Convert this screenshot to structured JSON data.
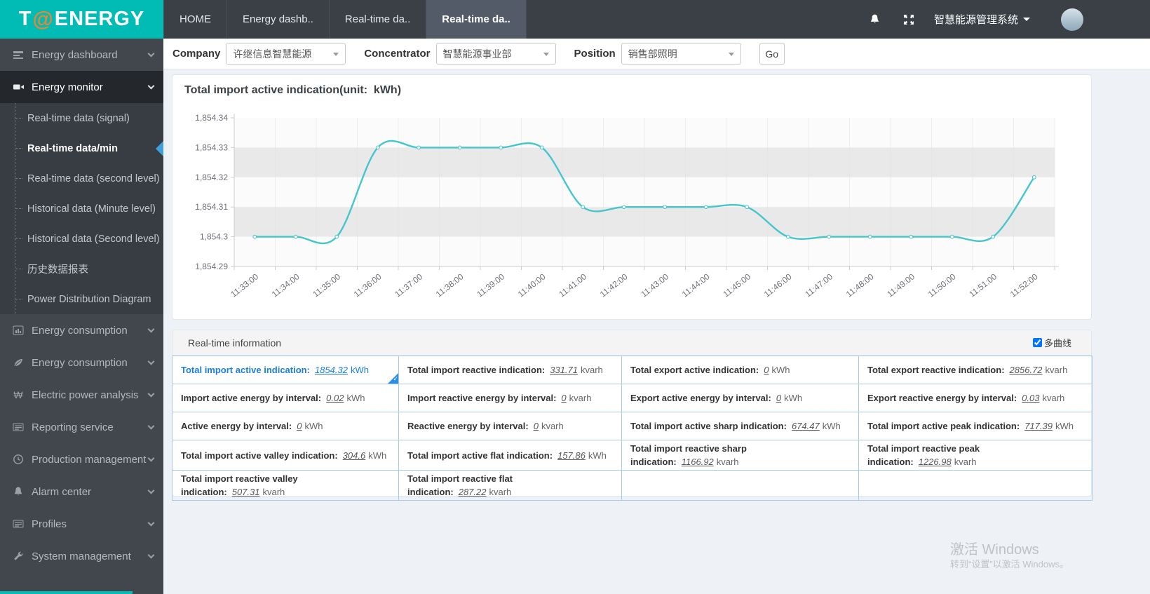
{
  "logo": {
    "t": "T",
    "at": "@",
    "rest": "ENERGY"
  },
  "top_nav": {
    "tabs": [
      {
        "label": "HOME",
        "active": false
      },
      {
        "label": "Energy dashb..",
        "active": false
      },
      {
        "label": "Real-time da..",
        "active": false
      },
      {
        "label": "Real-time da..",
        "active": true
      }
    ],
    "system_menu": "智慧能源管理系统",
    "icons": [
      "bell-icon",
      "fullscreen-icon",
      "user-avatar"
    ]
  },
  "sidebar": {
    "items": [
      {
        "label": "Energy dashboard",
        "icon": "dashboard-icon"
      },
      {
        "label": "Energy monitor",
        "icon": "video-camera-icon",
        "active": true,
        "children": [
          {
            "label": "Real-time data (signal)",
            "selected": false
          },
          {
            "label": "Real-time data/min",
            "selected": true
          },
          {
            "label": "Real-time data (second level)",
            "selected": false
          },
          {
            "label": "Historical data (Minute level)",
            "selected": false
          },
          {
            "label": "Historical data (Second level)",
            "selected": false
          },
          {
            "label": "历史数据报表",
            "selected": false
          },
          {
            "label": "Power Distribution Diagram",
            "selected": false
          }
        ]
      },
      {
        "label": "Energy consumption",
        "icon": "bar-chart-icon"
      },
      {
        "label": "Energy consumption",
        "icon": "leaf-icon"
      },
      {
        "label": "Electric power analysis",
        "icon": "won-sign-icon"
      },
      {
        "label": "Reporting service",
        "icon": "report-icon"
      },
      {
        "label": "Production management",
        "icon": "clock-icon"
      },
      {
        "label": "Alarm center",
        "icon": "bell-icon"
      },
      {
        "label": "Profiles",
        "icon": "list-icon"
      },
      {
        "label": "System management",
        "icon": "wrench-icon"
      }
    ]
  },
  "filters": {
    "company": {
      "label": "Company",
      "value": "许继信息智慧能源"
    },
    "concentrator": {
      "label": "Concentrator",
      "value": "智慧能源事业部"
    },
    "position": {
      "label": "Position",
      "value": "销售部照明"
    },
    "go_label": "Go"
  },
  "chart_panel": {
    "title": "Total import active indication(unit:  kWh)"
  },
  "chart_data": {
    "type": "line",
    "title": "Total import active indication(unit: kWh)",
    "x": [
      "11:33:00",
      "11:34:00",
      "11:35:00",
      "11:36:00",
      "11:37:00",
      "11:38:00",
      "11:39:00",
      "11:40:00",
      "11:41:00",
      "11:42:00",
      "11:43:00",
      "11:44:00",
      "11:45:00",
      "11:46:00",
      "11:47:00",
      "11:48:00",
      "11:49:00",
      "11:50:00",
      "11:51:00",
      "11:52:00"
    ],
    "series": [
      {
        "name": "Total import active indication",
        "values": [
          1854.3,
          1854.3,
          1854.3,
          1854.33,
          1854.33,
          1854.33,
          1854.33,
          1854.33,
          1854.31,
          1854.31,
          1854.31,
          1854.31,
          1854.31,
          1854.3,
          1854.3,
          1854.3,
          1854.3,
          1854.3,
          1854.3,
          1854.32
        ]
      }
    ],
    "ylim": [
      1854.29,
      1854.34
    ],
    "y_ticks": [
      "1,854.29",
      "1,854.3",
      "1,854.31",
      "1,854.32",
      "1,854.33",
      "1,854.34"
    ],
    "ylabel": "",
    "xlabel": "",
    "line_color": "#45c6cc",
    "grid": "horizontal-stripe-bands",
    "legend": "none"
  },
  "realtime": {
    "header": "Real-time information",
    "multi_curve_label": "多曲线",
    "multi_curve_checked": true,
    "rows": [
      {
        "cells": [
          {
            "label": "Total import active indication:",
            "value": "1854.32",
            "unit": "kWh",
            "selected": true
          },
          {
            "label": "Total import reactive indication:",
            "value": "331.71",
            "unit": "kvarh"
          },
          {
            "label": "Total export active indication:",
            "value": "0",
            "unit": "kWh"
          },
          {
            "label": "Total export reactive indication:",
            "value": "2856.72",
            "unit": "kvarh"
          }
        ]
      },
      {
        "cells": [
          {
            "label": "Import active energy by interval:",
            "value": "0.02",
            "unit": "kWh"
          },
          {
            "label": "Import reactive energy by interval:",
            "value": "0",
            "unit": "kvarh"
          },
          {
            "label": "Export active energy by interval:",
            "value": "0",
            "unit": "kWh"
          },
          {
            "label": "Export reactive energy by interval:",
            "value": "0.03",
            "unit": "kvarh"
          }
        ]
      },
      {
        "cells": [
          {
            "label": "Active energy by interval:",
            "value": "0",
            "unit": "kWh"
          },
          {
            "label": "Reactive energy by interval:",
            "value": "0",
            "unit": "kvarh"
          },
          {
            "label": "Total import active sharp indication:",
            "value": "674.47",
            "unit": "kWh"
          },
          {
            "label": "Total import active peak indication:",
            "value": "717.39",
            "unit": "kWh"
          }
        ]
      },
      {
        "cells": [
          {
            "label": "Total import active valley indication:",
            "value": "304.6",
            "unit": "kWh"
          },
          {
            "label": "Total import active flat indication:",
            "value": "157.86",
            "unit": "kWh"
          },
          {
            "label": "Total import reactive sharp indication:",
            "value": "1166.92",
            "unit": "kvarh"
          },
          {
            "label": "Total import reactive peak indication:",
            "value": "1226.98",
            "unit": "kvarh"
          }
        ]
      },
      {
        "cells": [
          {
            "label": "Total import reactive valley indication:",
            "value": "507.31",
            "unit": "kvarh"
          },
          {
            "label": "Total import reactive flat indication:",
            "value": "287.22",
            "unit": "kvarh"
          },
          {
            "label": "",
            "value": "",
            "unit": ""
          },
          {
            "label": "",
            "value": "",
            "unit": ""
          }
        ]
      }
    ]
  },
  "watermark": {
    "line1": "激活 Windows",
    "line2": "转到“设置”以激活 Windows。"
  }
}
